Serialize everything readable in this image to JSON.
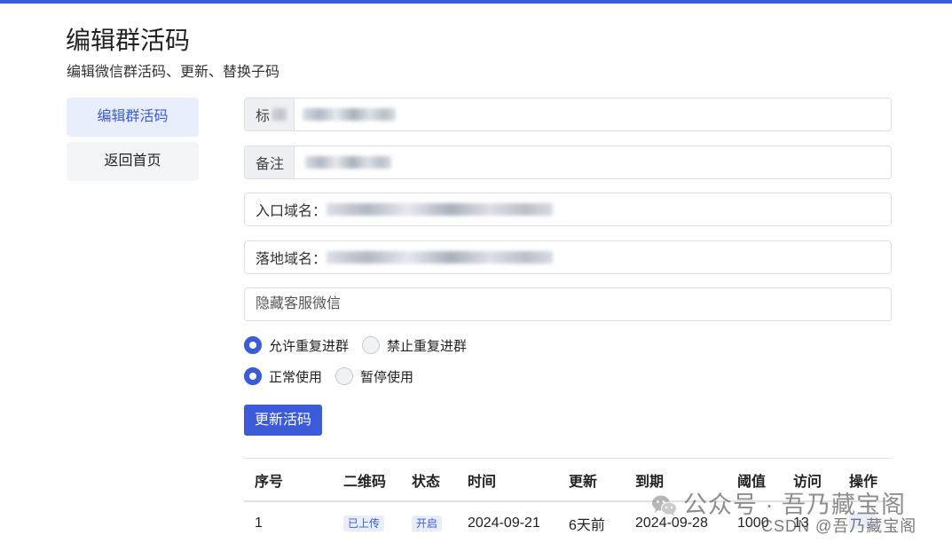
{
  "colors": {
    "accent": "#3b5bdb",
    "accent_soft": "#e8eefb",
    "top_bar": "#3b5bdb"
  },
  "page": {
    "title": "编辑群活码",
    "subtitle": "编辑微信群活码、更新、替换子码"
  },
  "sidebar": {
    "active_index": 0,
    "items": [
      {
        "label": "编辑群活码"
      },
      {
        "label": "返回首页"
      }
    ]
  },
  "form": {
    "title_field": {
      "addon": "标"
    },
    "remark_field": {
      "addon": "备注"
    },
    "entry_domain_field": {
      "prefix": "入口域名："
    },
    "landing_domain_field": {
      "prefix": "落地域名："
    },
    "hidden_wechat_field": {
      "placeholder": "隐藏客服微信",
      "value": ""
    },
    "repeat_join": {
      "selected_index": 0,
      "options": [
        "允许重复进群",
        "禁止重复进群"
      ]
    },
    "usage_status": {
      "selected_index": 0,
      "options": [
        "正常使用",
        "暂停使用"
      ]
    },
    "submit_button": {
      "label": "更新活码"
    }
  },
  "table": {
    "columns": [
      "序号",
      "二维码",
      "状态",
      "时间",
      "更新",
      "到期",
      "阈值",
      "访问",
      "操作"
    ],
    "rows": [
      {
        "index": "1",
        "qrcode": "已上传",
        "status": "开启",
        "time": "2024-09-21",
        "updated": "6天前",
        "expires": "2024-09-28",
        "threshold": "1000",
        "visits": "13"
      }
    ]
  },
  "watermark": {
    "icon": "wechat-icon",
    "wechat_text": "公众号 · 吾乃藏宝阁",
    "csdn_text": "CSDN @吾乃藏宝阁"
  }
}
